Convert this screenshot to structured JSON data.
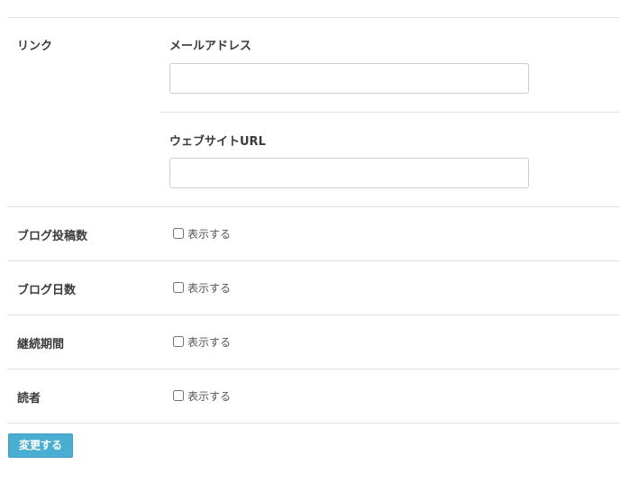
{
  "link_section": {
    "label": "リンク",
    "email": {
      "label": "メールアドレス",
      "value": "",
      "placeholder": ""
    },
    "website": {
      "label": "ウェブサイトURL",
      "value": "",
      "placeholder": ""
    }
  },
  "options": [
    {
      "label": "ブログ投稿数",
      "checkbox_label": "表示する",
      "checked": false
    },
    {
      "label": "ブログ日数",
      "checkbox_label": "表示する",
      "checked": false
    },
    {
      "label": "継続期間",
      "checkbox_label": "表示する",
      "checked": false
    },
    {
      "label": "読者",
      "checkbox_label": "表示する",
      "checked": false
    }
  ],
  "submit_label": "変更する",
  "colors": {
    "accent": "#4aaed3",
    "divider": "#e3e3e3"
  }
}
